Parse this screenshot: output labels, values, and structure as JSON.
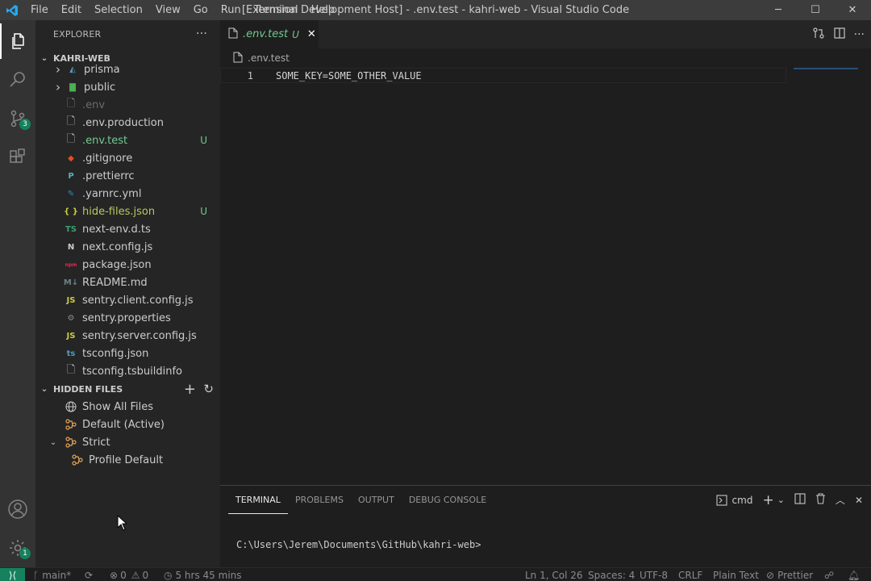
{
  "window": {
    "title": "[Extension Development Host] - .env.test - kahri-web - Visual Studio Code",
    "menu": [
      "File",
      "Edit",
      "Selection",
      "View",
      "Go",
      "Run",
      "Terminal",
      "Help"
    ],
    "controls": {
      "minimize": "─",
      "maximize": "☐",
      "close": "✕"
    }
  },
  "activity": {
    "scm_badge": "3",
    "settings_badge": "1"
  },
  "sidebar": {
    "title": "EXPLORER",
    "more": "···",
    "folder": "KAHRI-WEB",
    "files": [
      {
        "label": "prisma",
        "type": "folder",
        "icon_color": "#519aba",
        "icon": "◭"
      },
      {
        "label": "public",
        "type": "folder",
        "icon_color": "#4caf50",
        "icon": "▇"
      },
      {
        "label": ".env",
        "type": "file",
        "icon_color": "#8b8b8b",
        "icon": "🗋",
        "dim": true
      },
      {
        "label": ".env.production",
        "type": "file",
        "icon_color": "#c5c5c5",
        "icon": "🗋"
      },
      {
        "label": ".env.test",
        "type": "file",
        "icon_color": "#c5c5c5",
        "icon": "🗋",
        "status": "U",
        "modified": true
      },
      {
        "label": ".gitignore",
        "type": "file",
        "icon_color": "#e44d26",
        "icon": "◆"
      },
      {
        "label": ".prettierrc",
        "type": "file",
        "icon_color": "#56b3b4",
        "icon": "P"
      },
      {
        "label": ".yarnrc.yml",
        "type": "file",
        "icon_color": "#2c8ebb",
        "icon": "✎"
      },
      {
        "label": "hide-files.json",
        "type": "file",
        "icon_color": "#cbcb41",
        "icon": "{ }",
        "status": "U",
        "modified": true
      },
      {
        "label": "next-env.d.ts",
        "type": "file",
        "icon_color": "#519aba",
        "icon": "TS",
        "tsgreen": true
      },
      {
        "label": "next.config.js",
        "type": "file",
        "icon_color": "#cccccc",
        "icon": "N"
      },
      {
        "label": "package.json",
        "type": "file",
        "icon_color": "#e8274b",
        "icon": "npm"
      },
      {
        "label": "README.md",
        "type": "file",
        "icon_color": "#6d8086",
        "icon": "M↓"
      },
      {
        "label": "sentry.client.config.js",
        "type": "file",
        "icon_color": "#cbcb41",
        "icon": "JS"
      },
      {
        "label": "sentry.properties",
        "type": "file",
        "icon_color": "#8b8b8b",
        "icon": "⚙"
      },
      {
        "label": "sentry.server.config.js",
        "type": "file",
        "icon_color": "#cbcb41",
        "icon": "JS"
      },
      {
        "label": "tsconfig.json",
        "type": "file",
        "icon_color": "#519aba",
        "icon": "ts"
      },
      {
        "label": "tsconfig.tsbuildinfo",
        "type": "file",
        "icon_color": "#c5c5c5",
        "icon": "🗋"
      }
    ],
    "hidden_files": {
      "title": "HIDDEN FILES",
      "items": [
        {
          "label": "Show All Files",
          "icon": "globe"
        },
        {
          "label": "Default (Active)",
          "icon": "profile"
        },
        {
          "label": "Strict",
          "icon": "profile"
        },
        {
          "label": "Profile Default",
          "icon": "profile"
        }
      ]
    }
  },
  "editor": {
    "tab": {
      "label": ".env.test",
      "status": "U"
    },
    "breadcrumb": ".env.test",
    "lines": [
      {
        "num": "1",
        "code": "SOME_KEY=SOME_OTHER_VALUE"
      }
    ]
  },
  "panel": {
    "tabs": [
      "TERMINAL",
      "PROBLEMS",
      "OUTPUT",
      "DEBUG CONSOLE"
    ],
    "shell": "cmd",
    "prompt": "C:\\Users\\Jerem\\Documents\\GitHub\\kahri-web>"
  },
  "status": {
    "branch": "main*",
    "errors": "0",
    "warnings": "0",
    "time": "5 hrs 45 mins",
    "position": "Ln 1, Col 26",
    "spaces": "Spaces: 4",
    "encoding": "UTF-8",
    "eol": "CRLF",
    "language": "Plain Text",
    "formatter": "Prettier"
  },
  "colors": {
    "accent": "#007acc",
    "untracked": "#73c991",
    "remote": "#16825d"
  }
}
